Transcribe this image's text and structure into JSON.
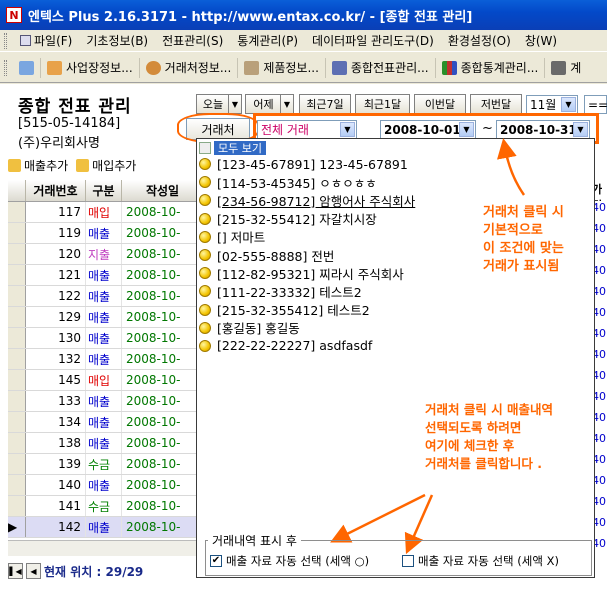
{
  "window": {
    "title": "엔텍스 Plus 2.16.3171 - http://www.entax.co.kr/ - [종합 전표 관리]",
    "icon_glyph": "N"
  },
  "menubar": {
    "items": [
      {
        "label": "파일(F)",
        "icon": "file-icon"
      },
      {
        "label": "기초정보(B)",
        "icon": "info-icon"
      },
      {
        "label": "전표관리(S)",
        "icon": "slip-icon"
      },
      {
        "label": "통계관리(P)",
        "icon": "stats-icon"
      },
      {
        "label": "데이터파일 관리도구(D)",
        "icon": "data-icon"
      },
      {
        "label": "환경설정(O)",
        "icon": "settings-icon"
      },
      {
        "label": "창(W)",
        "icon": "window-icon"
      }
    ]
  },
  "toolbar": {
    "items": [
      {
        "label": "",
        "icon": "refresh-icon"
      },
      {
        "label": "사업장정보...",
        "icon": "business-icon"
      },
      {
        "label": "거래처정보...",
        "icon": "vendor-icon"
      },
      {
        "label": "제품정보...",
        "icon": "product-icon"
      },
      {
        "label": "종합전표관리...",
        "icon": "slip-icon"
      },
      {
        "label": "종합통계관리...",
        "icon": "chart-icon"
      },
      {
        "label": "계",
        "icon": "calc-icon"
      }
    ]
  },
  "company": {
    "title": "종합 전표 관리",
    "reg_no": "[515-05-14184]",
    "name": "(주)우리회사명"
  },
  "date_buttons": [
    "오늘",
    "어제",
    "최근7일",
    "최근1달",
    "이번달",
    "저번달"
  ],
  "month_select": "11월",
  "extra_select": "==",
  "filter": {
    "vendor_button": "거래처",
    "type_select": "전체 거래",
    "date_from": "2008-10-01",
    "date_sep": "~",
    "date_to": "2008-10-31"
  },
  "actions": {
    "sales_add": "매출추가",
    "purchase_add": "매입추가"
  },
  "grid": {
    "headers": [
      "거래번호",
      "구분",
      "작성일"
    ],
    "rows": [
      {
        "no": "117",
        "type": "매입",
        "date": "2008-10-",
        "color": "#e00000"
      },
      {
        "no": "119",
        "type": "매출",
        "date": "2008-10-",
        "color": "#0000cc"
      },
      {
        "no": "120",
        "type": "지출",
        "date": "2008-10-",
        "color": "#c040c0"
      },
      {
        "no": "121",
        "type": "매출",
        "date": "2008-10-",
        "color": "#0000cc"
      },
      {
        "no": "122",
        "type": "매출",
        "date": "2008-10-",
        "color": "#0000cc"
      },
      {
        "no": "129",
        "type": "매출",
        "date": "2008-10-",
        "color": "#0000cc"
      },
      {
        "no": "130",
        "type": "매출",
        "date": "2008-10-",
        "color": "#0000cc"
      },
      {
        "no": "132",
        "type": "매출",
        "date": "2008-10-",
        "color": "#0000cc"
      },
      {
        "no": "145",
        "type": "매입",
        "date": "2008-10-",
        "color": "#e00000"
      },
      {
        "no": "133",
        "type": "매출",
        "date": "2008-10-",
        "color": "#0000cc"
      },
      {
        "no": "134",
        "type": "매출",
        "date": "2008-10-",
        "color": "#0000cc"
      },
      {
        "no": "138",
        "type": "매출",
        "date": "2008-10-",
        "color": "#0000cc"
      },
      {
        "no": "139",
        "type": "수금",
        "date": "2008-10-",
        "color": "#008000"
      },
      {
        "no": "140",
        "type": "매출",
        "date": "2008-10-",
        "color": "#0000cc"
      },
      {
        "no": "141",
        "type": "수금",
        "date": "2008-10-",
        "color": "#008000"
      },
      {
        "no": "142",
        "type": "매출",
        "date": "2008-10-",
        "color": "#0000cc",
        "selected": true
      }
    ]
  },
  "status": {
    "position_label": "현재 위치 : 29/29"
  },
  "right_column": {
    "header": "가격",
    "values": [
      "40",
      "40",
      "40",
      "40",
      "40",
      "40",
      "40",
      "40",
      "40",
      "40",
      "40",
      "40",
      "40",
      "40",
      "40",
      "40",
      "40"
    ]
  },
  "popup": {
    "all_label": "모두 보기",
    "vendors": [
      "[123-45-67891] 123-45-67891",
      "[114-53-45345] ㅇㅎㅇㅎㅎ",
      "[234-56-98712] 암행어사 주식회사",
      "[215-32-55412] 자갈치시장",
      "[] 저마트",
      "[02-555-8888] 전번",
      "[112-82-95321] 찌라시 주식회사",
      "[111-22-33332] 테스트2",
      "[215-32-355412] 테스트2",
      "[홍길동] 홍길동",
      "[222-22-22227] asdfasdf"
    ]
  },
  "annotations": {
    "top_note": [
      "거래처 클릭 시",
      "기본적으로",
      "이 조건에 맞는",
      "거래가 표시됨"
    ],
    "bottom_note": [
      "거래처 클릭 시 매출내역",
      "선택되도록 하려면",
      "여기에 체크한 후",
      "거래처를 클릭합니다 ."
    ]
  },
  "options": {
    "group_label": "거래내역 표시 후",
    "auto_select_vat": {
      "label": "매출 자료 자동 선택 (세액 ○)",
      "checked": true
    },
    "auto_select_no_vat": {
      "label": "매출 자료 자동 선택 (세액 X)",
      "checked": false
    }
  },
  "colors": {
    "accent": "#ff6600",
    "title_bar": "#0a4fcc",
    "selected_tag": "#316ac5"
  }
}
